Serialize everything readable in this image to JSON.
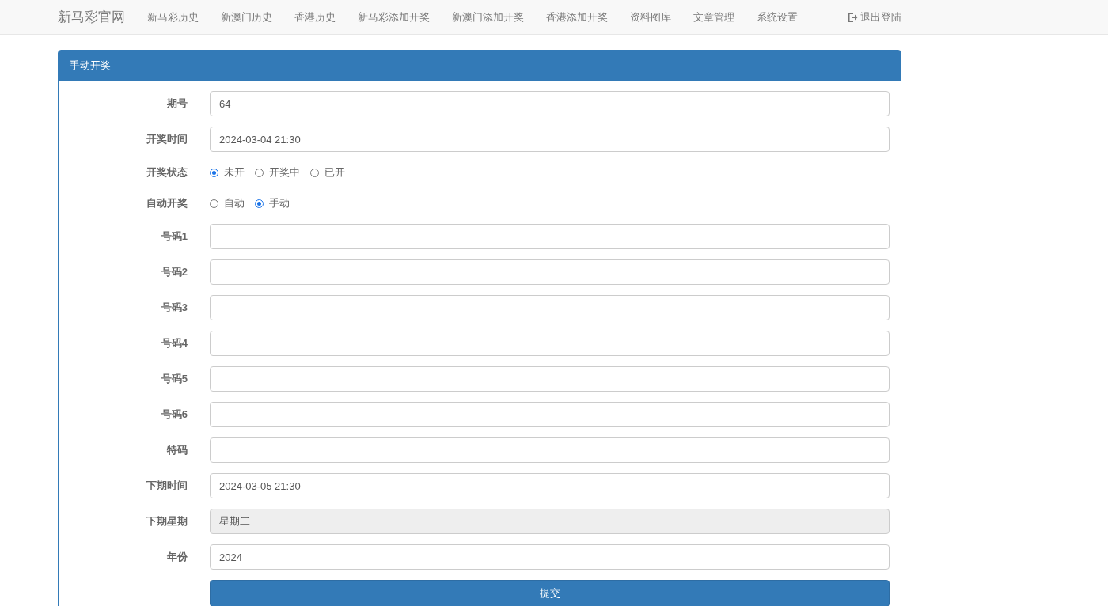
{
  "navbar": {
    "brand": "新马彩官网",
    "items": [
      {
        "label": "新马彩历史"
      },
      {
        "label": "新澳门历史"
      },
      {
        "label": "香港历史"
      },
      {
        "label": "新马彩添加开奖"
      },
      {
        "label": "新澳门添加开奖"
      },
      {
        "label": "香港添加开奖"
      },
      {
        "label": "资料图库"
      },
      {
        "label": "文章管理"
      },
      {
        "label": "系统设置"
      }
    ],
    "logout": "退出登陆"
  },
  "panel": {
    "title": "手动开奖",
    "fields": [
      {
        "kind": "text",
        "label": "期号",
        "value": "64"
      },
      {
        "kind": "text",
        "label": "开奖时间",
        "value": "2024-03-04 21:30"
      },
      {
        "kind": "radio",
        "label": "开奖状态",
        "options": [
          {
            "label": "未开",
            "selected": true
          },
          {
            "label": "开奖中",
            "selected": false
          },
          {
            "label": "已开",
            "selected": false
          }
        ]
      },
      {
        "kind": "radio",
        "label": "自动开奖",
        "options": [
          {
            "label": "自动",
            "selected": false
          },
          {
            "label": "手动",
            "selected": true
          }
        ]
      },
      {
        "kind": "text",
        "label": "号码1"
      },
      {
        "kind": "text",
        "label": "号码2"
      },
      {
        "kind": "text",
        "label": "号码3"
      },
      {
        "kind": "text",
        "label": "号码4"
      },
      {
        "kind": "text",
        "label": "号码5"
      },
      {
        "kind": "text",
        "label": "号码6"
      },
      {
        "kind": "text",
        "label": "特码"
      },
      {
        "kind": "text",
        "label": "下期时间",
        "value": "2024-03-05 21:30"
      },
      {
        "kind": "readonly",
        "label": "下期星期",
        "value": "星期二"
      },
      {
        "kind": "text",
        "label": "年份",
        "value": "2024"
      }
    ],
    "submit": "提交"
  }
}
